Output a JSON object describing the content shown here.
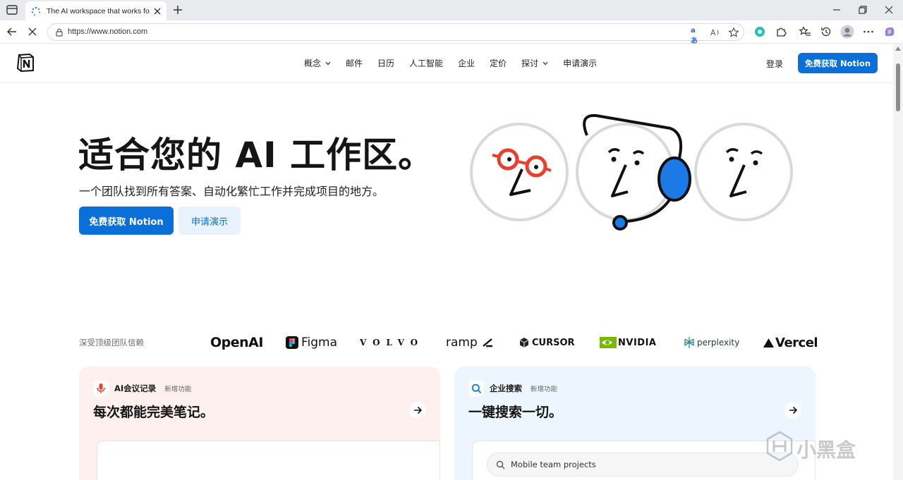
{
  "browser": {
    "tab_title": "The AI workspace that works for y",
    "url": "https://www.notion.com",
    "reader_label": "aあ"
  },
  "nav": {
    "items": [
      {
        "label": "概念",
        "has_menu": true
      },
      {
        "label": "邮件",
        "has_menu": false
      },
      {
        "label": "日历",
        "has_menu": false
      },
      {
        "label": "人工智能",
        "has_menu": false
      },
      {
        "label": "企业",
        "has_menu": false
      },
      {
        "label": "定价",
        "has_menu": false
      },
      {
        "label": "探讨",
        "has_menu": true
      },
      {
        "label": "申请演示",
        "has_menu": false
      }
    ],
    "login": "登录",
    "cta": "免费获取 Notion"
  },
  "hero": {
    "title": "适合您的 AI 工作区。",
    "subtitle": "一个团队找到所有答案、自动化繁忙工作并完成项目的地方。",
    "primary_cta": "免费获取 Notion",
    "secondary_cta": "申请演示"
  },
  "trust": {
    "label": "深受顶级团队信赖",
    "logos": [
      "OpenAI",
      "Figma",
      "VOLVO",
      "ramp",
      "CURSOR",
      "NVIDIA",
      "perplexity",
      "Vercel"
    ]
  },
  "cards": [
    {
      "tag": "AI会议记录",
      "badge": "新增功能",
      "heading": "每次都能完美笔记。",
      "icon": "microphone-icon"
    },
    {
      "tag": "企业搜索",
      "badge": "新增功能",
      "heading": "一键搜索一切。",
      "icon": "search-icon",
      "search_placeholder": "Mobile team projects"
    }
  ],
  "watermark": "小黑盒",
  "colors": {
    "accent": "#0b6fd9",
    "accent_light": "#e9f3fd",
    "card_red": "#fdf0ee",
    "card_blue": "#edf5fe"
  }
}
